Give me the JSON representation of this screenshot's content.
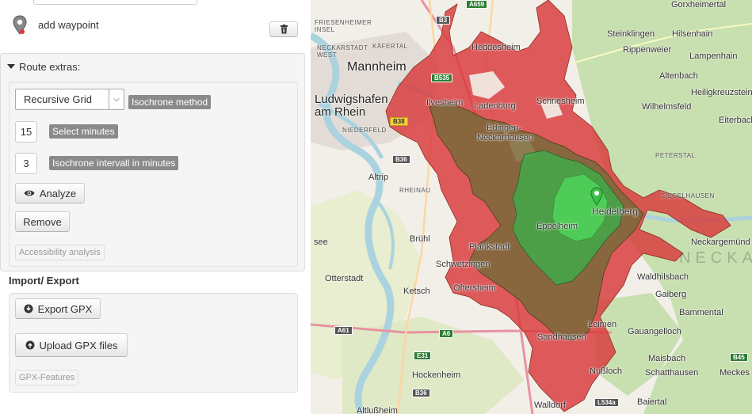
{
  "sidebar": {
    "add_waypoint_label": "add waypoint",
    "route_extras_label": "Route extras:",
    "isochrone": {
      "method_selected": "Recursive Grid",
      "method_label": "Isochrone method",
      "minutes_value": "15",
      "minutes_label": "Select minutes",
      "interval_value": "3",
      "interval_label": "Isochrone intervall in minutes"
    },
    "analyze_label": "Analyze",
    "remove_label": "Remove",
    "accessibility_label": "Accessibility analysis",
    "import_export_heading": "Import/ Export",
    "export_gpx_label": "Export GPX",
    "upload_gpx_label": "Upload GPX files",
    "gpx_features_label": "GPX-Features"
  },
  "map": {
    "places": {
      "mannheim": "Mannheim",
      "ludwigshafen": "Ludwigshafen",
      "am_rhein": "am Rhein",
      "heddesheim": "Heddesheim",
      "ladenburg": "Ladenburg",
      "schriesheim": "Schriesheim",
      "ilvesheim": "Ilvesheim",
      "edingen": "Edingen-",
      "neckarhausen": "Neckarhausen",
      "heidelberg": "Heidelberg",
      "eppelheim": "Eppelheim",
      "altrip": "Altrip",
      "bruehl": "Brühl",
      "schwetzingen": "Schwetzingen",
      "plankstadt": "Plankstadt",
      "oftersheim": "Oftersheim",
      "ketsch": "Ketsch",
      "otterstadt": "Otterstadt",
      "sandhausen": "Sandhausen",
      "leimen": "Leimen",
      "nussloch": "Nußloch",
      "hockenheim": "Hockenheim",
      "walldorf": "Walldorf",
      "altlussheim": "Altlußheim",
      "gorxheimertal": "Gorxheimertal",
      "steinklingen": "Steinklingen",
      "hilsenhain": "Hilsenhain",
      "rippenweier": "Rippenweier",
      "lampenhain": "Lampenhain",
      "altenbach": "Altenbach",
      "wilhelmsfeld": "Wilhelmsfeld",
      "heiligkreuzsteinach": "Heiligkreuzsteinach",
      "eiterbach": "Eiterbach",
      "neckargemuend": "Neckargemünd",
      "waldhilsbach": "Waldhilsbach",
      "gaiberg": "Gaiberg",
      "bammental": "Bammental",
      "gauangelloch": "Gauangelloch",
      "maisbach": "Maisbach",
      "schatthausen": "Schatthausen",
      "meckesheim": "Meckes",
      "baiertal": "Baiertal",
      "friesenheimer_insel": "FRIESENHEIMER\nINSEL",
      "neckarstadt_west": "NECKARSTADT\nWEST",
      "kafertal": "KÄFERTAL",
      "niederfeld": "NIEDERFELD",
      "rheinau": "RHEINAU",
      "peterstal": "PETERSTAL",
      "ziegelhausen": "ZIEGELHAUSEN",
      "neckar_faint": "NECKAR",
      "see": "see"
    },
    "roads": [
      "B38",
      "A659",
      "A6",
      "B36",
      "A61",
      "B45",
      "E31",
      "B3",
      "B535",
      "L534a"
    ],
    "colors": {
      "red_zone": "#d9393b",
      "olive_zone": "#7a6a3a",
      "green_zone": "#3fae4a",
      "bright_green": "#4fd35a",
      "forest": "#c9dfb3",
      "water": "#aad3df"
    },
    "marker": "map-pin-icon"
  }
}
